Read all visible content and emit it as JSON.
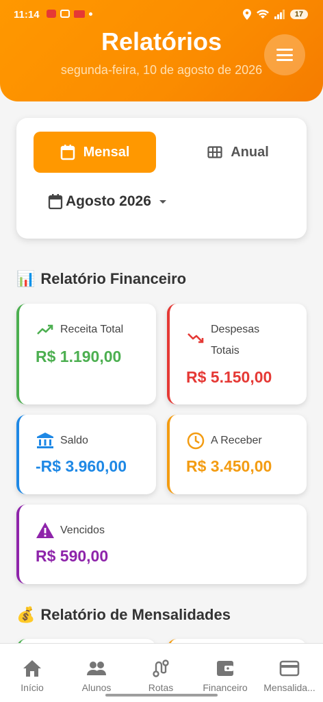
{
  "status_bar": {
    "time": "11:14",
    "battery": "17"
  },
  "header": {
    "title": "Relatórios",
    "date": "segunda-feira, 10 de agosto de 2026"
  },
  "period": {
    "mensal_label": "Mensal",
    "anual_label": "Anual",
    "month": "Agosto 2026"
  },
  "financial": {
    "title": "Relatório Financeiro",
    "title_icon": "📊",
    "cards": {
      "receita": {
        "label": "Receita Total",
        "value": "R$ 1.190,00",
        "color": "#4caf50"
      },
      "despesas": {
        "label_1": "Despesas",
        "label_2": "Totais",
        "value": "R$ 5.150,00",
        "color": "#e53935"
      },
      "saldo": {
        "label": "Saldo",
        "value": "-R$ 3.960,00",
        "color": "#1e88e5"
      },
      "receber": {
        "label": "A Receber",
        "value": "R$ 3.450,00",
        "color": "#f39c12"
      },
      "vencidos": {
        "label": "Vencidos",
        "value": "R$ 590,00",
        "color": "#8e24aa"
      }
    }
  },
  "mensalidades": {
    "title": "Relatório de Mensalidades",
    "title_icon": "💰"
  },
  "nav": {
    "inicio": "Início",
    "alunos": "Alunos",
    "rotas": "Rotas",
    "financeiro": "Financeiro",
    "mensalidades": "Mensalida..."
  }
}
